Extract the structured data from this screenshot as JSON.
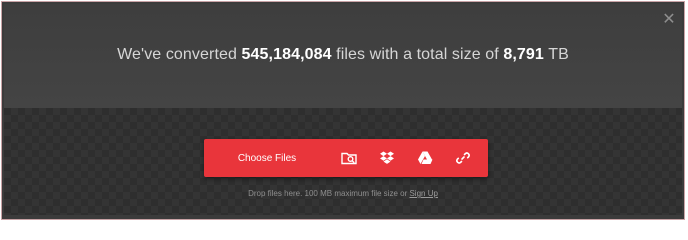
{
  "headline": {
    "prefix": "We've converted",
    "files_count": "545,184,084",
    "middle": "files with a total size of",
    "total_size": "8,791",
    "unit": "TB"
  },
  "upload": {
    "choose_files_label": "Choose Files",
    "icons": [
      "folder-search-icon",
      "dropbox-icon",
      "google-drive-icon",
      "link-icon"
    ]
  },
  "hint": {
    "text": "Drop files here. 100 MB maximum file size or",
    "signup_label": "Sign Up"
  },
  "colors": {
    "accent": "#e9353b",
    "background_top": "#414141",
    "background_bottom": "#2e2e2e"
  }
}
